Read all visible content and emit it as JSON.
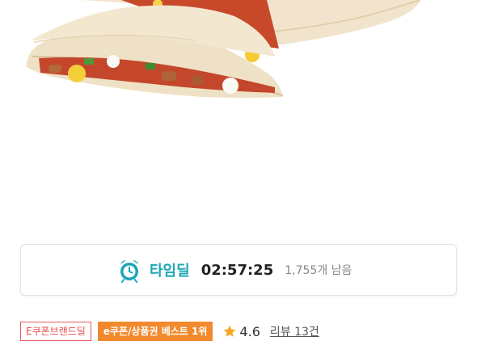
{
  "timedeal": {
    "label": "타임딜",
    "timer": "02:57:25",
    "stock": "1,755개 남음"
  },
  "tags": {
    "brand_deal": "E쿠폰브랜드딜",
    "best": "e쿠폰/상품권 베스트 1위"
  },
  "rating": {
    "score": "4.6",
    "reviews": "리뷰 13건"
  },
  "colors": {
    "timedeal_accent": "#1aa6b7",
    "best_tag": "#f28a2d",
    "brand_tag": "#e64b4b",
    "star": "#f5a623"
  },
  "icons": {
    "clock": "alarm-clock-icon",
    "star": "star-icon"
  }
}
